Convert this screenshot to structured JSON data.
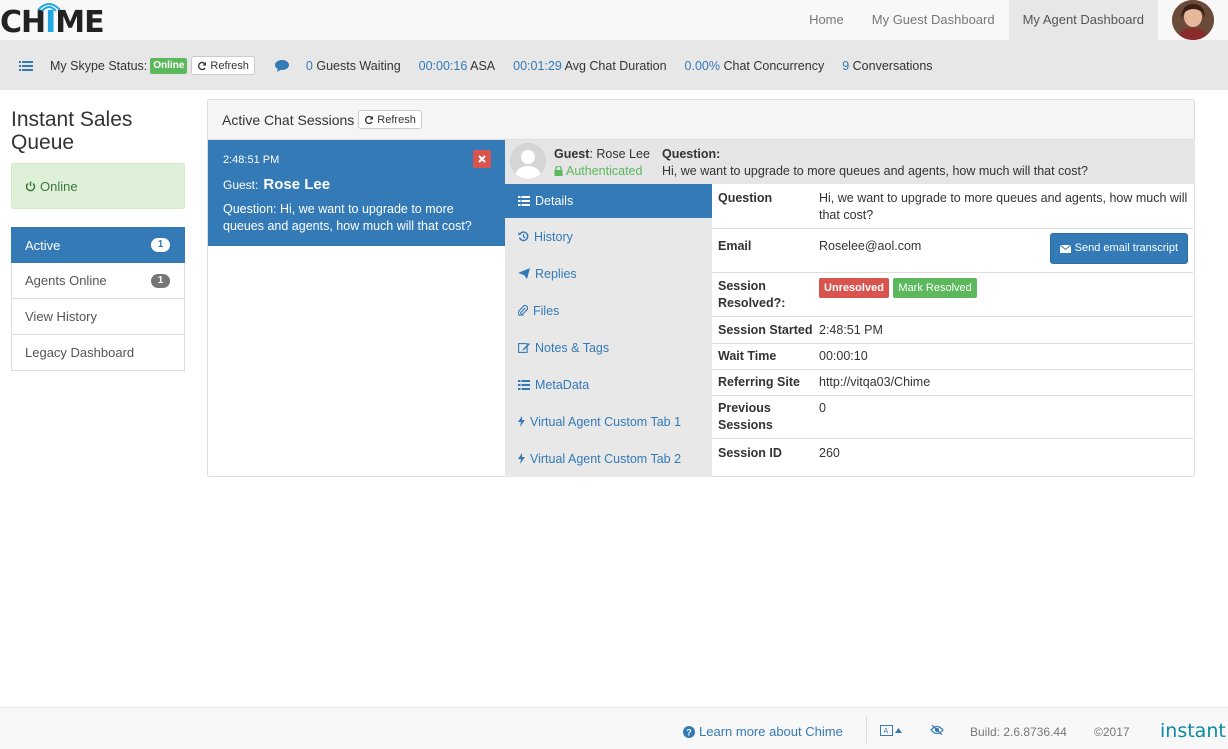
{
  "brand": {
    "logo_a": "CH",
    "logo_b": "I",
    "logo_c": "ME"
  },
  "nav": {
    "home": "Home",
    "guest_dashboard": "My Guest Dashboard",
    "agent_dashboard": "My Agent Dashboard"
  },
  "status": {
    "skype_label": "My Skype Status:",
    "skype_value": "Online",
    "refresh": "Refresh",
    "guests_waiting_num": "0",
    "guests_waiting_label": "Guests Waiting",
    "asa_num": "00:00:16",
    "asa_label": "ASA",
    "avg_num": "00:01:29",
    "avg_label": "Avg Chat Duration",
    "conc_num": "0.00%",
    "conc_label": "Chat Concurrency",
    "conv_num": "9",
    "conv_label": "Conversations"
  },
  "queue": {
    "title": "Instant Sales Queue",
    "online": "Online",
    "items": [
      {
        "label": "Active",
        "count": "1"
      },
      {
        "label": "Agents Online",
        "count": "1"
      },
      {
        "label": "View History"
      },
      {
        "label": "Legacy Dashboard"
      }
    ]
  },
  "sessions": {
    "title": "Active Chat Sessions",
    "refresh": "Refresh",
    "card": {
      "time": "2:48:51 PM",
      "guest_label": "Guest:",
      "guest_name": "Rose Lee",
      "question_label": "Question:",
      "question": "Hi, we want to upgrade to more queues and agents, how much will that cost?"
    }
  },
  "guest_header": {
    "guest_label": "Guest",
    "guest_name": "Rose Lee",
    "auth": "Authenticated",
    "question_label": "Question",
    "question": "Hi, we want to upgrade to more queues and agents, how much will that cost?"
  },
  "tabs": [
    "Details",
    "History",
    "Replies",
    "Files",
    "Notes & Tags",
    "MetaData",
    "Virtual Agent Custom Tab 1",
    "Virtual Agent Custom Tab 2"
  ],
  "details": {
    "question_k": "Question",
    "question_v": "Hi, we want to upgrade to more queues and agents, how much will that cost?",
    "email_k": "Email",
    "email_v": "Roselee@aol.com",
    "send_transcript": "Send email transcript",
    "resolved_k": "Session Resolved?:",
    "unresolved": "Unresolved",
    "mark_resolved": "Mark Resolved",
    "started_k": "Session Started",
    "started_v": "2:48:51 PM",
    "wait_k": "Wait Time",
    "wait_v": "00:00:10",
    "ref_k": "Referring Site",
    "ref_v": "http://vitqa03/Chime",
    "prev_k": "Previous Sessions",
    "prev_v": "0",
    "id_k": "Session ID",
    "id_v": "260"
  },
  "footer": {
    "learn": "Learn more about Chime",
    "build": "Build: 2.6.8736.44",
    "copyright": "©2017",
    "logo_a": "instant",
    "logo_b": "."
  }
}
